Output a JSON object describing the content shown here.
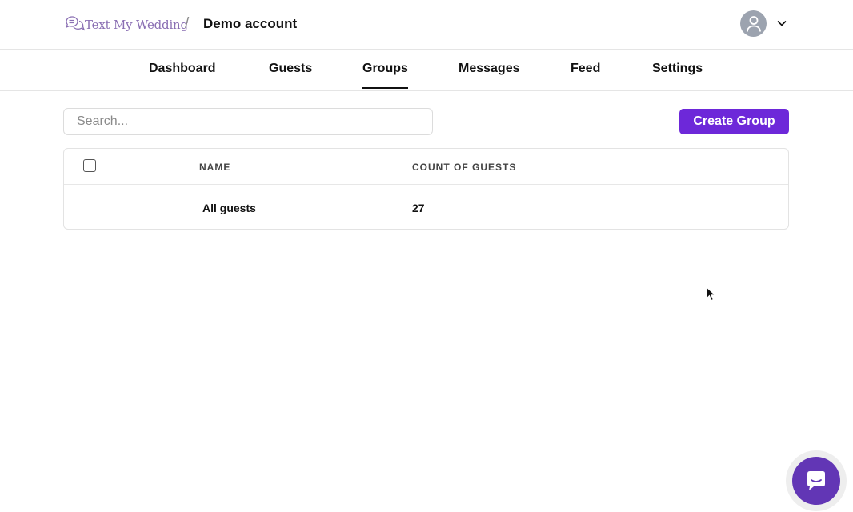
{
  "header": {
    "brand_name": "Text My Wedding",
    "separator": "/",
    "account_name": "Demo account"
  },
  "nav": {
    "tabs": [
      {
        "label": "Dashboard",
        "active": false
      },
      {
        "label": "Guests",
        "active": false
      },
      {
        "label": "Groups",
        "active": true
      },
      {
        "label": "Messages",
        "active": false
      },
      {
        "label": "Feed",
        "active": false
      },
      {
        "label": "Settings",
        "active": false
      }
    ]
  },
  "toolbar": {
    "search_placeholder": "Search...",
    "create_label": "Create Group"
  },
  "table": {
    "columns": [
      "NAME",
      "COUNT OF GUESTS"
    ],
    "rows": [
      {
        "name": "All guests",
        "count": "27",
        "selected": false
      }
    ],
    "header_checkbox_checked": false
  },
  "colors": {
    "accent": "#6d28d9",
    "brand_text": "#8a6fb3",
    "chat_button": "#6236b5",
    "avatar_bg": "#9ca3af"
  },
  "icons": {
    "brand": "chat-bubbles-icon",
    "avatar": "user-icon",
    "menu": "chevron-down-icon",
    "chat": "chat-icon",
    "pointer": "mouse-cursor-icon"
  }
}
